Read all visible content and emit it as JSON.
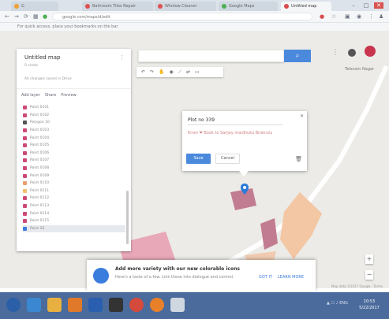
{
  "browser": {
    "tabs": [
      {
        "label": "G",
        "favicon_color": "#f0a030"
      },
      {
        "label": "Bathroom Tiles Repair",
        "favicon_color": "#e05050"
      },
      {
        "label": "Window Cleaner",
        "favicon_color": "#e05050"
      },
      {
        "label": "Google Maps",
        "favicon_color": "#4caf50"
      },
      {
        "label": "Untitled map",
        "favicon_color": "#d94a4a"
      }
    ],
    "url": "google.com/maps/d/edit",
    "bookmarks_hint": "For quick access, place your bookmarks on the bar",
    "window_controls": [
      "–",
      "□",
      "✕"
    ]
  },
  "panel": {
    "title": "Untitled map",
    "views": "0 views",
    "owner": "All changes saved in Drive",
    "toolbar": [
      "Add layer",
      "Share",
      "Preview"
    ],
    "layers": [
      {
        "label": "Point 0101",
        "color": "#cc4a7a"
      },
      {
        "label": "Point 0102",
        "color": "#cc4a7a"
      },
      {
        "label": "Polygon 10",
        "color": "#555555"
      },
      {
        "label": "Point 0103",
        "color": "#cc4a7a"
      },
      {
        "label": "Point 0104",
        "color": "#cc4a7a"
      },
      {
        "label": "Point 0105",
        "color": "#cc4a7a"
      },
      {
        "label": "Point 0106",
        "color": "#cc4a7a"
      },
      {
        "label": "Point 0107",
        "color": "#cc4a7a"
      },
      {
        "label": "Point 0108",
        "color": "#cc4a7a"
      },
      {
        "label": "Point 0109",
        "color": "#cc4a7a"
      },
      {
        "label": "Point 0110",
        "color": "#e8a070"
      },
      {
        "label": "Point 0111",
        "color": "#f0c070"
      },
      {
        "label": "Point 0112",
        "color": "#cc4a7a"
      },
      {
        "label": "Point 0113",
        "color": "#cc4a7a"
      },
      {
        "label": "Point 0114",
        "color": "#cc4a7a"
      },
      {
        "label": "Point 0115",
        "color": "#cc4a7a"
      },
      {
        "label": "Point 26",
        "color": "#3b7ddd"
      }
    ]
  },
  "search": {
    "placeholder": ""
  },
  "tools": [
    "↶",
    "↷",
    "✋",
    "◉",
    "⟋",
    "⇄",
    "▭"
  ],
  "popup": {
    "title": "Plot no 339",
    "description": "Kiran ❤ Book to Sanjay maidhuku Brokrutu",
    "save_label": "Save",
    "cancel_label": "Cancel"
  },
  "toast": {
    "title": "Add more variety with our new colorable icons",
    "body": "Here's a taste of a few. Link these into dialogue and control.",
    "got_it": "GOT IT",
    "learn_more": "LEARN MORE"
  },
  "place_label": "Telecom Nagar",
  "map_footer": "Map data ©2017 Google · Terms",
  "taskbar": {
    "tray": "▲ ☐ ♪ ENG",
    "time": "10:53",
    "date": "5/22/2017",
    "icons": [
      {
        "name": "start",
        "color": "#2b5fa8"
      },
      {
        "name": "ie",
        "color": "#3b87d1"
      },
      {
        "name": "explorer",
        "color": "#e8b040"
      },
      {
        "name": "media",
        "color": "#e07a2a"
      },
      {
        "name": "word",
        "color": "#2a5fb0"
      },
      {
        "name": "terminal",
        "color": "#333333"
      },
      {
        "name": "chrome",
        "color": "#d64a3b"
      },
      {
        "name": "firefox",
        "color": "#e8802a"
      },
      {
        "name": "notes",
        "color": "#cfd7e0"
      }
    ]
  }
}
